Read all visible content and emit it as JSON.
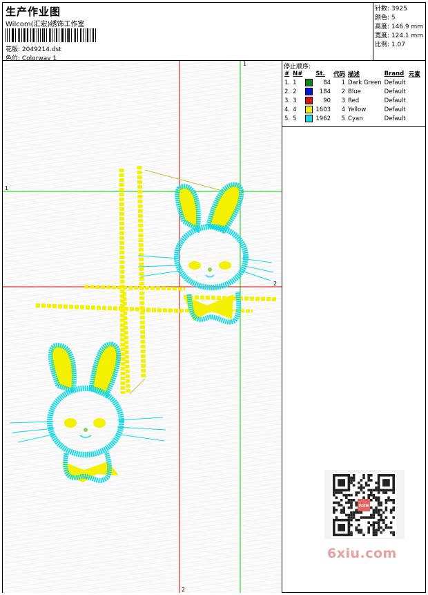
{
  "header": {
    "title": "生产作业图",
    "company": "Wilcom(汇宏)绣饰工作室",
    "design_label": "花版: 2049214.dst",
    "colorway_label": "色位: Colorway 1"
  },
  "specs": {
    "stitches": "针数: 3925",
    "colors": "颜色: 5",
    "height": "高度: 146.9 mm",
    "width": "宽度: 124.1 mm",
    "scale": "比例: 1.07"
  },
  "stop_sequence": {
    "title": "停止顺序:",
    "headers": [
      "#",
      "N#",
      "St.",
      "代码",
      "描述",
      "Brand",
      "元素"
    ],
    "rows": [
      {
        "num": "1.",
        "n": "1",
        "hex": "#0a8a1a",
        "st": "84",
        "code": "1",
        "desc": "Dark Green",
        "brand": "Default"
      },
      {
        "num": "2.",
        "n": "2",
        "hex": "#0a14d8",
        "st": "184",
        "code": "2",
        "desc": "Blue",
        "brand": "Default"
      },
      {
        "num": "3.",
        "n": "3",
        "hex": "#e01010",
        "st": "90",
        "code": "3",
        "desc": "Red",
        "brand": "Default"
      },
      {
        "num": "4.",
        "n": "4",
        "hex": "#f5f000",
        "st": "1603",
        "code": "4",
        "desc": "Yellow",
        "brand": "Default"
      },
      {
        "num": "5.",
        "n": "5",
        "hex": "#16d8e6",
        "st": "1962",
        "code": "5",
        "desc": "Cyan",
        "brand": "Default"
      }
    ]
  },
  "guides": {
    "green_label_1": "1",
    "green_label_top": "1",
    "red_label_2": "2",
    "red_label_bottom": "2"
  },
  "colors": {
    "yellow": "#f5f000",
    "cyan": "#16d8e6",
    "guide_green": "#00d000",
    "guide_red": "#e00000"
  },
  "watermark": {
    "text": "6xiu.com",
    "stamp": "刺绣图"
  }
}
